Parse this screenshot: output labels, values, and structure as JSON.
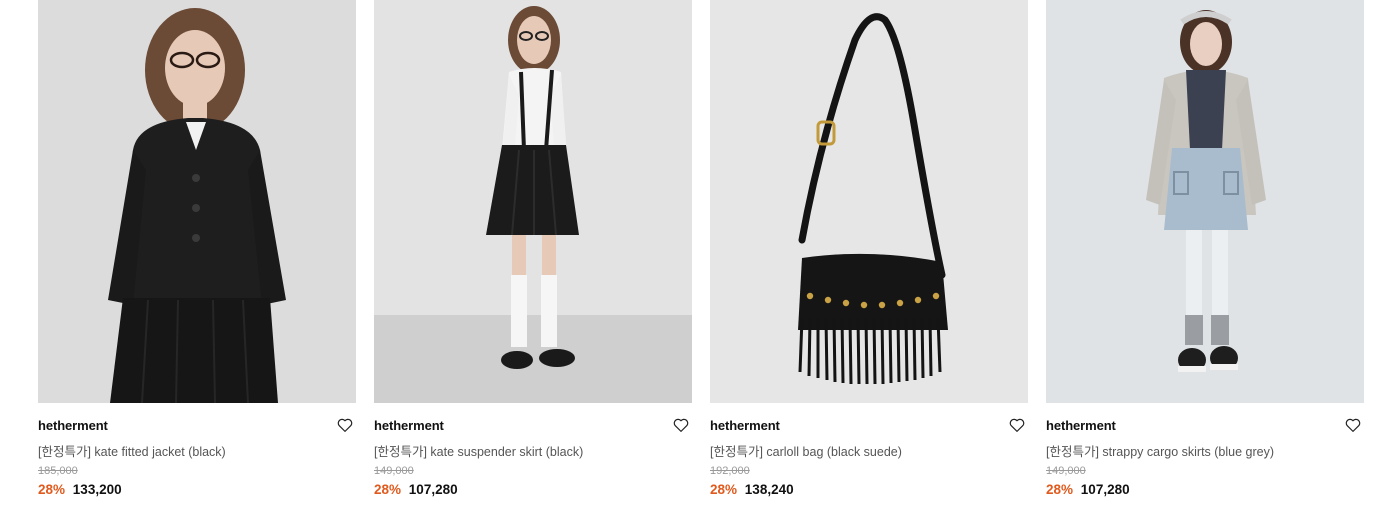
{
  "products": [
    {
      "brand": "hetherment",
      "name": "[한정특가] kate fitted jacket (black)",
      "original_price": "185,000",
      "discount": "28%",
      "price": "133,200",
      "image": "model-black-fitted-jacket"
    },
    {
      "brand": "hetherment",
      "name": "[한정특가] kate suspender skirt (black)",
      "original_price": "149,000",
      "discount": "28%",
      "price": "107,280",
      "image": "model-black-suspender-skirt"
    },
    {
      "brand": "hetherment",
      "name": "[한정특가] carloll bag (black suede)",
      "original_price": "192,000",
      "discount": "28%",
      "price": "138,240",
      "image": "black-suede-fringe-bag"
    },
    {
      "brand": "hetherment",
      "name": "[한정특가] strappy cargo skirts (blue grey)",
      "original_price": "149,000",
      "discount": "28%",
      "price": "107,280",
      "image": "model-blue-grey-cargo-skirt"
    }
  ],
  "colors": {
    "discount": "#e05a1e",
    "brand_text": "#111111",
    "name_text": "#555555",
    "original_price_text": "#9a9a9a"
  },
  "icons": {
    "wishlist": "heart-outline-icon"
  }
}
